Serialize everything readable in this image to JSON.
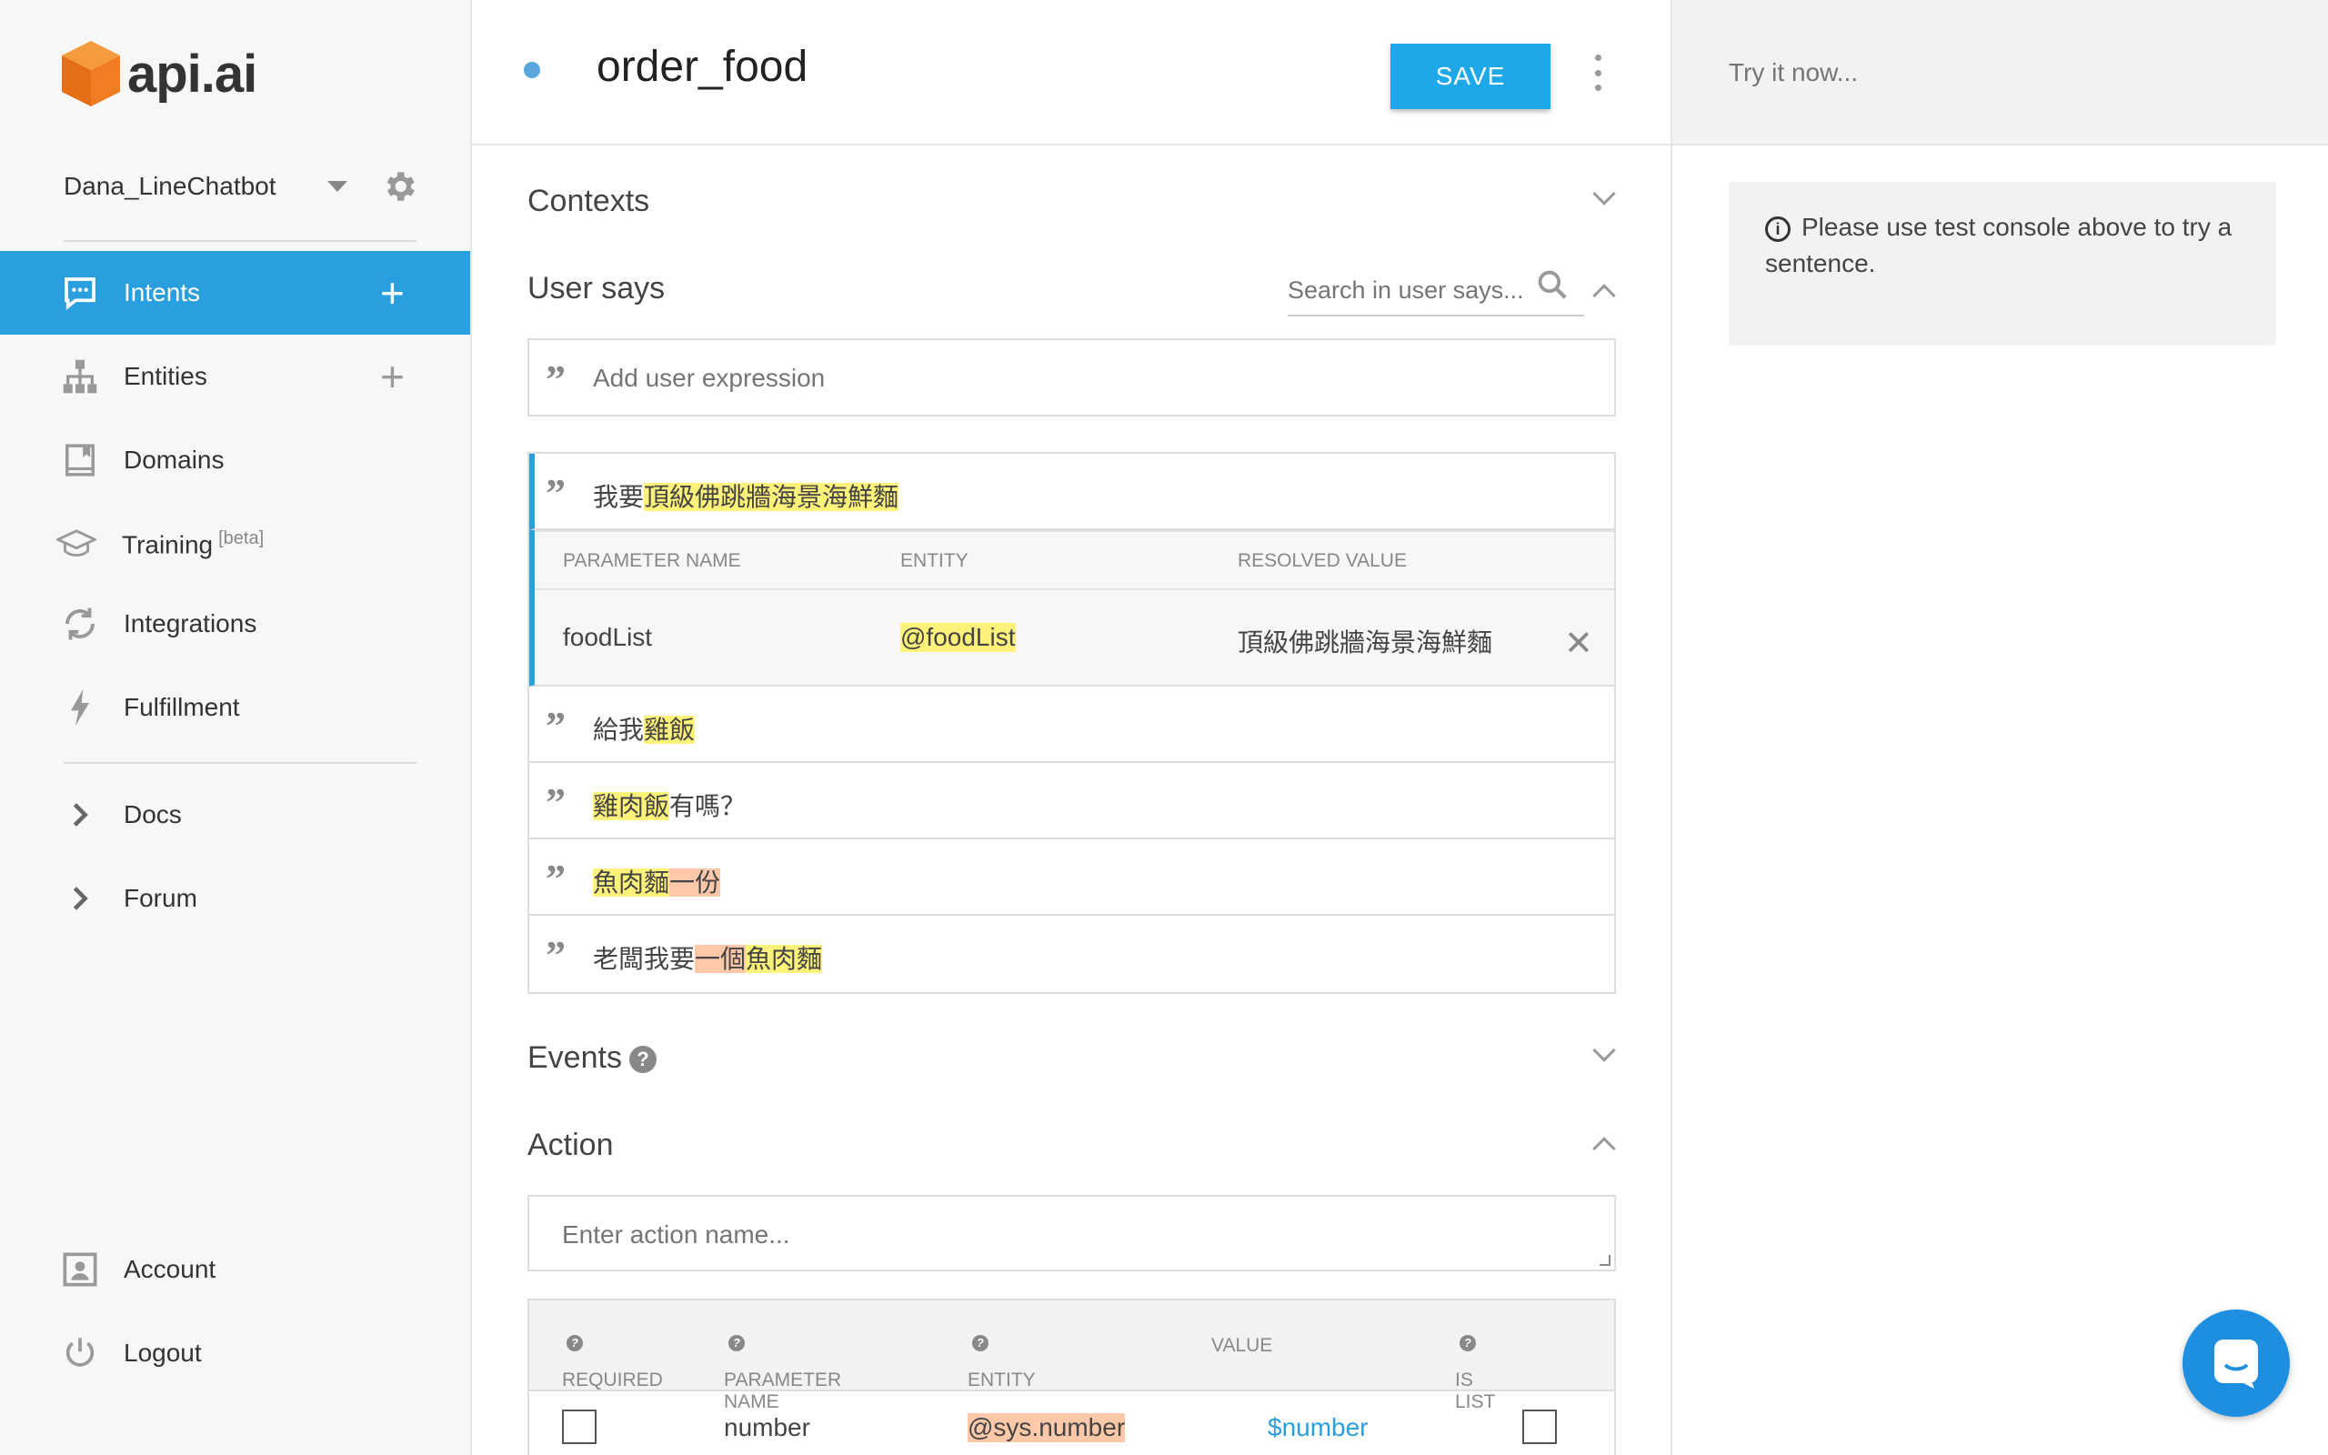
{
  "app": {
    "logo_text": "api.ai",
    "brand_color": "#f07d23",
    "accent_color": "#2a9fe0"
  },
  "sidebar": {
    "agent_name": "Dana_LineChatbot",
    "items": [
      {
        "label": "Intents",
        "icon": "chat-bubble-icon",
        "has_add": true,
        "active": true
      },
      {
        "label": "Entities",
        "icon": "hierarchy-icon",
        "has_add": true
      },
      {
        "label": "Domains",
        "icon": "book-icon"
      },
      {
        "label": "Training",
        "badge": "[beta]",
        "icon": "graduation-cap-icon"
      },
      {
        "label": "Integrations",
        "icon": "refresh-icon"
      },
      {
        "label": "Fulfillment",
        "icon": "lightning-icon"
      },
      {
        "label": "Docs",
        "icon": "chevron-right-icon"
      },
      {
        "label": "Forum",
        "icon": "chevron-right-icon"
      },
      {
        "label": "Account",
        "icon": "account-icon"
      },
      {
        "label": "Logout",
        "icon": "power-icon"
      }
    ]
  },
  "header": {
    "intent_name": "order_food",
    "save_label": "SAVE"
  },
  "sections": {
    "contexts": "Contexts",
    "user_says": "User says",
    "search_placeholder": "Search in user says...",
    "add_expression_placeholder": "Add user expression",
    "events": "Events",
    "action": "Action",
    "action_placeholder": "Enter action name..."
  },
  "expressions": [
    {
      "pre": "我要",
      "hl": "頂級佛跳牆海景海鮮麵",
      "hl_color": "yellow",
      "post": ""
    },
    {
      "pre": "給我",
      "hl": "雞飯",
      "hl_color": "yellow",
      "post": ""
    },
    {
      "pre": "",
      "hl": "雞肉飯",
      "hl_color": "yellow",
      "post": "有嗎？"
    },
    {
      "pre": "",
      "hl": "魚肉麵",
      "hl_color": "yellow",
      "hl2": "一份",
      "hl2_color": "orange",
      "post": ""
    },
    {
      "pre": "老闆我要",
      "hl": "一個",
      "hl_color": "orange",
      "hl2": "魚肉麵",
      "hl2_color": "yellow",
      "post": ""
    }
  ],
  "param_table": {
    "headers": [
      "PARAMETER NAME",
      "ENTITY",
      "RESOLVED VALUE"
    ],
    "row": {
      "name": "foodList",
      "entity": "@foodList",
      "value": "頂級佛跳牆海景海鮮麵"
    }
  },
  "action_params": {
    "headers": [
      "REQUIRED",
      "PARAMETER NAME",
      "ENTITY",
      "VALUE",
      "IS LIST"
    ],
    "rows": [
      {
        "required": false,
        "name": "number",
        "entity": "@sys.number",
        "value": "$number",
        "is_list": false
      }
    ]
  },
  "right_panel": {
    "try_placeholder": "Try it now...",
    "info_text": "Please use test console above to try a sentence."
  }
}
